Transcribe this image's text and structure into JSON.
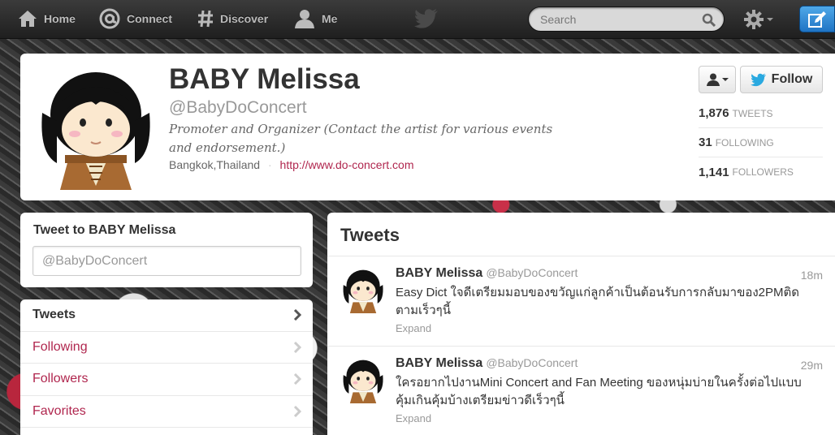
{
  "nav": {
    "home_label": "Home",
    "connect_label": "Connect",
    "discover_label": "Discover",
    "me_label": "Me",
    "search_placeholder": "Search",
    "icons": [
      "home-icon",
      "at-icon",
      "hash-icon",
      "person-icon",
      "bird-icon",
      "search-icon",
      "gear-icon",
      "compose-icon"
    ]
  },
  "profile": {
    "name": "BABY Melissa",
    "handle": "@BabyDoConcert",
    "bio": "Promoter and Organizer (Contact the artist for various events and endorsement.)",
    "location": "Bangkok,Thailand",
    "location_separator": "·",
    "url": "http://www.do-concert.com",
    "follow_label": "Follow",
    "stats": [
      {
        "count": "1,876",
        "label": "TWEETS"
      },
      {
        "count": "31",
        "label": "FOLLOWING"
      },
      {
        "count": "1,141",
        "label": "FOLLOWERS"
      }
    ]
  },
  "tweet_box": {
    "title": "Tweet to BABY Melissa",
    "value": "",
    "placeholder": "@BabyDoConcert"
  },
  "side_nav": {
    "items": [
      {
        "label": "Tweets",
        "active": true
      },
      {
        "label": "Following",
        "active": false
      },
      {
        "label": "Followers",
        "active": false
      },
      {
        "label": "Favorites",
        "active": false
      }
    ]
  },
  "timeline": {
    "title": "Tweets",
    "tweets": [
      {
        "name": "BABY Melissa",
        "handle": "@BabyDoConcert",
        "time": "18m",
        "text": "Easy Dict ใจดีเตรียมมอบของขวัญแก่ลูกค้าเป็นต้อนรับการกลับมาของ2PMติดตามเร็วๆนี้",
        "expand": "Expand"
      },
      {
        "name": "BABY Melissa",
        "handle": "@BabyDoConcert",
        "time": "29m",
        "text": "ใครอยากไปงานMini Concert and Fan Meeting ของหนุ่มบ่ายในครั้งต่อไปแบบคุ้มเกินคุ้มบ้างเตรียมข่าวดีเร็วๆนี้",
        "expand": "Expand"
      }
    ]
  },
  "colors": {
    "link": "#b0264e",
    "compose_button": "#1f74c4",
    "topbar": "#2b2b2b",
    "twitter_blue": "#2aa9e0"
  }
}
